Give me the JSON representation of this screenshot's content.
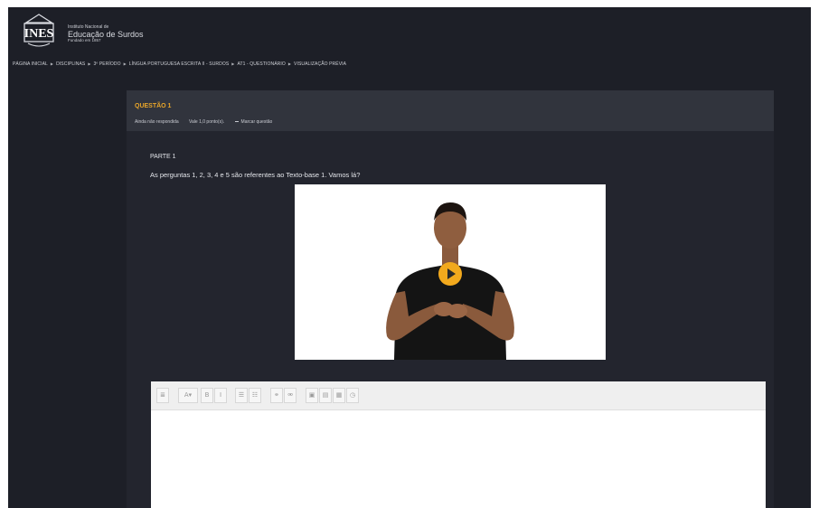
{
  "header": {
    "logo_text": "INES",
    "institution_line1": "Instituto Nacional de",
    "institution_line2": "Educação de Surdos",
    "institution_line3": "Fundado em 1857"
  },
  "breadcrumb": [
    "PÁGINA INICIAL",
    "DISCIPLINAS",
    "3º PERÍODO",
    "LÍNGUA PORTUGUESA ESCRITA II - SURDOS",
    "AT1 - QUESTIONÁRIO",
    "VISUALIZAÇÃO PRÉVIA"
  ],
  "question": {
    "title": "QUESTÃO 1",
    "status": "Ainda não respondida",
    "points": "Vale 1,0 ponto(s).",
    "flag_label": "Marcar questão",
    "part_label": "PARTE 1",
    "prompt": "As perguntas 1, 2, 3, 4 e 5 são referentes ao Texto-base 1. Vamos lá?"
  },
  "video": {
    "play_icon": "play-icon",
    "accent": "#f2a91d"
  },
  "editor": {
    "toolbar_buttons": [
      {
        "icon": "toggle-toolbar-icon",
        "glyph": "≣"
      },
      {
        "icon": "font-style-icon",
        "glyph": "A▾"
      },
      {
        "icon": "bold-icon",
        "glyph": "B"
      },
      {
        "icon": "italic-icon",
        "glyph": "I"
      },
      {
        "icon": "bullet-list-icon",
        "glyph": "☰"
      },
      {
        "icon": "numbered-list-icon",
        "glyph": "☷"
      },
      {
        "icon": "link-icon",
        "glyph": "⚭"
      },
      {
        "icon": "unlink-icon",
        "glyph": "⚮"
      },
      {
        "icon": "image-icon",
        "glyph": "▣"
      },
      {
        "icon": "media-icon",
        "glyph": "▤"
      },
      {
        "icon": "file-manager-icon",
        "glyph": "▦"
      },
      {
        "icon": "record-icon",
        "glyph": "◷"
      }
    ]
  },
  "colors": {
    "background": "#1d1f27",
    "panel": "#23252e",
    "panel_header": "#31343d",
    "accent": "#e8a52a"
  }
}
